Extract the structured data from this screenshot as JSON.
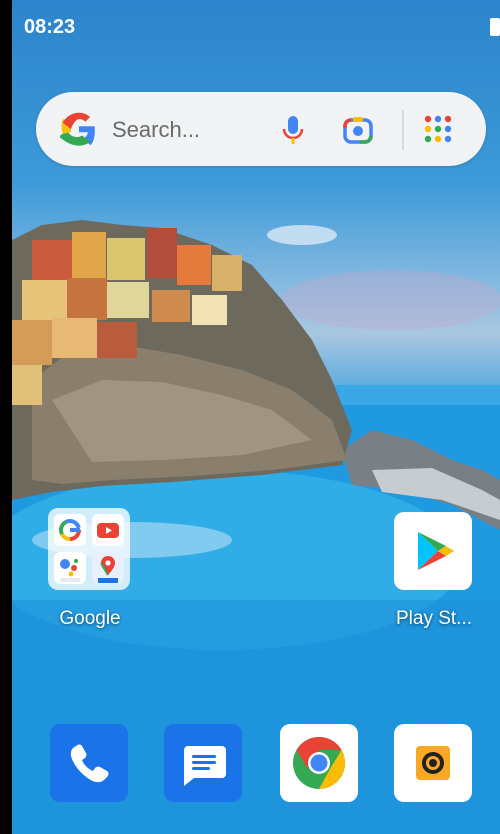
{
  "status_bar": {
    "time": "08:23"
  },
  "search_widget": {
    "placeholder": "Search..."
  },
  "home": {
    "folder": {
      "label": "Google",
      "apps": [
        "Google",
        "YouTube",
        "Assistant Go",
        "Maps Go"
      ]
    },
    "play_store": {
      "label": "Play St..."
    }
  },
  "dock": {
    "apps": [
      "Phone",
      "Messages",
      "Chrome",
      "Camera"
    ]
  },
  "colors": {
    "google_blue": "#4285F4",
    "google_red": "#EA4335",
    "google_yellow": "#FBBC05",
    "google_green": "#34A853",
    "dock_blue": "#1a73e8",
    "camera_orange": "#f9a825"
  },
  "icons": [
    "battery-icon",
    "google-g-icon",
    "mic-icon",
    "lens-icon",
    "apps-grid-icon",
    "play-store-icon",
    "phone-icon",
    "messages-icon",
    "chrome-icon",
    "camera-icon"
  ]
}
